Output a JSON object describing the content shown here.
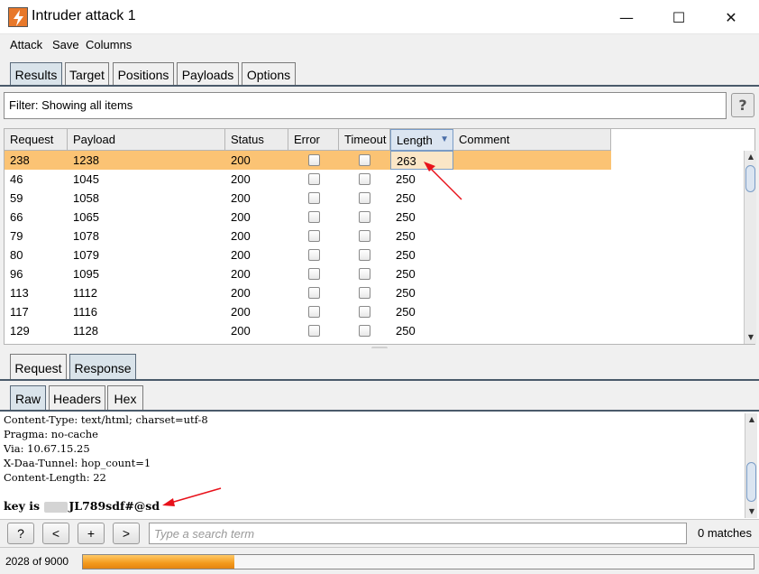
{
  "window": {
    "title": "Intruder attack 1",
    "minimize": "—",
    "maximize": "☐",
    "close": "✕"
  },
  "menu": [
    "Attack",
    "Save",
    "Columns"
  ],
  "tabs": [
    "Results",
    "Target",
    "Positions",
    "Payloads",
    "Options"
  ],
  "filter": {
    "text": "Filter: Showing all items",
    "help": "?"
  },
  "table": {
    "columns": [
      "Request",
      "Payload",
      "Status",
      "Error",
      "Timeout",
      "Length",
      "Comment"
    ],
    "sort_indicator": "▼",
    "rows": [
      {
        "request": "238",
        "payload": "1238",
        "status": "200",
        "length": "263"
      },
      {
        "request": "46",
        "payload": "1045",
        "status": "200",
        "length": "250"
      },
      {
        "request": "59",
        "payload": "1058",
        "status": "200",
        "length": "250"
      },
      {
        "request": "66",
        "payload": "1065",
        "status": "200",
        "length": "250"
      },
      {
        "request": "79",
        "payload": "1078",
        "status": "200",
        "length": "250"
      },
      {
        "request": "80",
        "payload": "1079",
        "status": "200",
        "length": "250"
      },
      {
        "request": "96",
        "payload": "1095",
        "status": "200",
        "length": "250"
      },
      {
        "request": "113",
        "payload": "1112",
        "status": "200",
        "length": "250"
      },
      {
        "request": "117",
        "payload": "1116",
        "status": "200",
        "length": "250"
      },
      {
        "request": "129",
        "payload": "1128",
        "status": "200",
        "length": "250"
      }
    ],
    "scroll_up": "▲",
    "scroll_down": "▼"
  },
  "rr_tabs": [
    "Request",
    "Response"
  ],
  "view_tabs": [
    "Raw",
    "Headers",
    "Hex"
  ],
  "response": {
    "lines": [
      "Content-Type: text/html; charset=utf-8",
      "Pragma: no-cache",
      "Via: 10.67.15.25",
      "X-Daa-Tunnel: hop_count=1",
      "Content-Length: 22"
    ],
    "key_prefix": "key is ",
    "key_value": "JL789sdf#@sd"
  },
  "search": {
    "help": "?",
    "prev": "<",
    "add": "+",
    "next": ">",
    "placeholder": "Type a search term",
    "matches": "0 matches"
  },
  "status": {
    "text": "2028 of 9000",
    "progress": 0.2253
  },
  "colors": {
    "selected_row": "#fbc374",
    "progress": "#f39a1c",
    "annotation_arrow": "#e8111a"
  }
}
